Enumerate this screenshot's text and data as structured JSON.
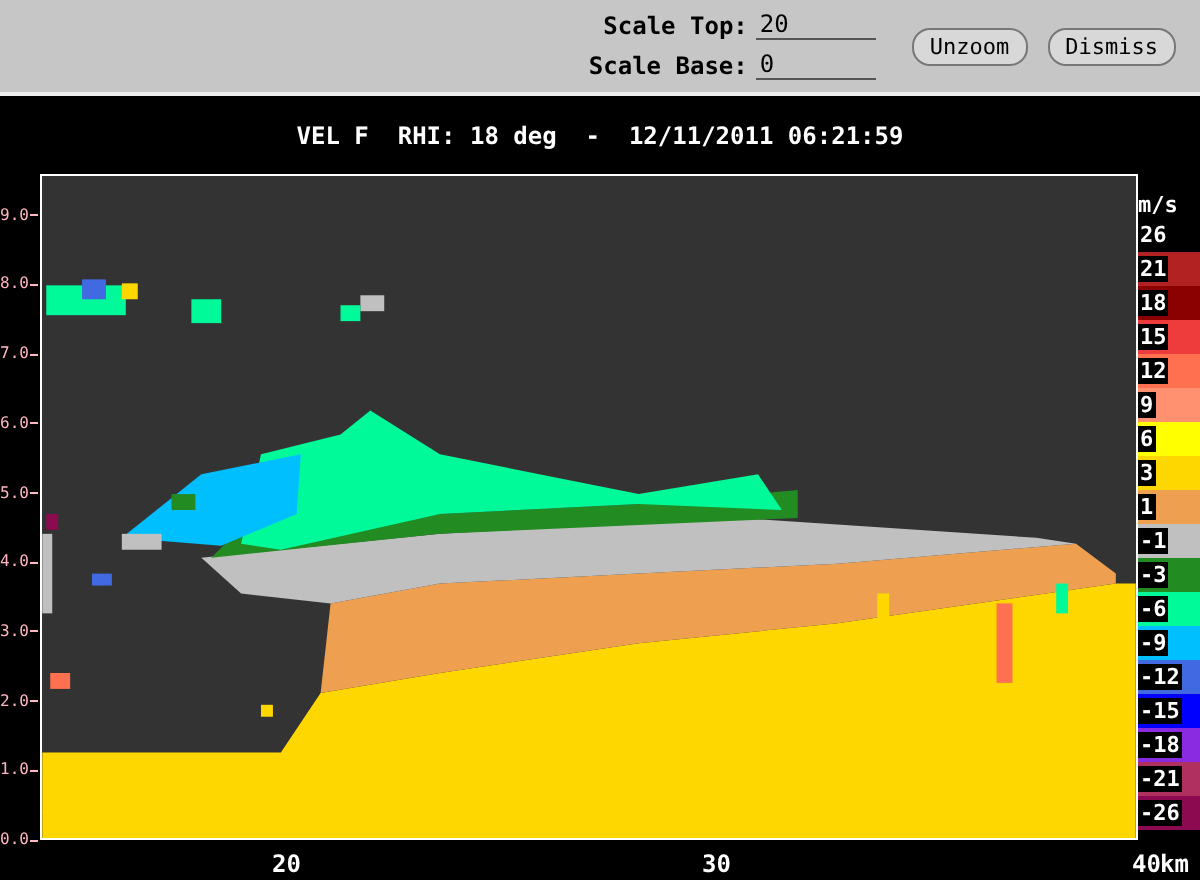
{
  "controls": {
    "fields": [
      {
        "label": "Scale Top:",
        "value": "20"
      },
      {
        "label": "Scale Base:",
        "value": "0"
      }
    ],
    "buttons": [
      "Unzoom",
      "Dismiss"
    ]
  },
  "plot_title": "VEL F  RHI: 18 deg  -  12/11/2011 06:21:59",
  "y_axis": {
    "ticks": [
      "9.0",
      "8.0",
      "7.0",
      "6.0",
      "5.0",
      "4.0",
      "3.0",
      "2.0",
      "1.0",
      "0.0"
    ]
  },
  "x_axis": {
    "ticks": [
      "20",
      "30",
      "40"
    ],
    "unit": "km"
  },
  "legend": {
    "unit": "m/s",
    "items": [
      {
        "label": "26",
        "color": "#000000"
      },
      {
        "label": "21",
        "color": "#b22222"
      },
      {
        "label": "18",
        "color": "#8b0000"
      },
      {
        "label": "15",
        "color": "#ee3b3b"
      },
      {
        "label": "12",
        "color": "#ff7050"
      },
      {
        "label": "9",
        "color": "#ff9070"
      },
      {
        "label": "6",
        "color": "#ffff00"
      },
      {
        "label": "3",
        "color": "#ffd700"
      },
      {
        "label": "1",
        "color": "#eea050"
      },
      {
        "label": "-1",
        "color": "#c0c0c0"
      },
      {
        "label": "-3",
        "color": "#228b22"
      },
      {
        "label": "-6",
        "color": "#00fa9a"
      },
      {
        "label": "-9",
        "color": "#00bfff"
      },
      {
        "label": "-12",
        "color": "#4169e1"
      },
      {
        "label": "-15",
        "color": "#0000ff"
      },
      {
        "label": "-18",
        "color": "#8a2be2"
      },
      {
        "label": "-21",
        "color": "#b03060"
      },
      {
        "label": "-26",
        "color": "#8b0a50"
      }
    ]
  }
}
